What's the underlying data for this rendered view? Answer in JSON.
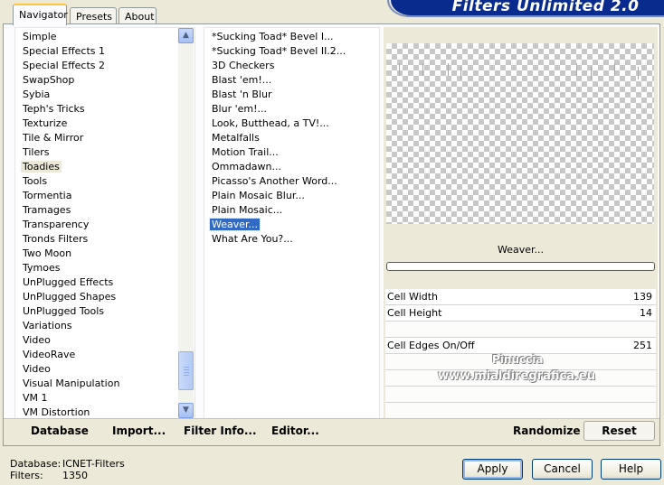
{
  "banner": {
    "title": "Filters Unlimited 2.0"
  },
  "tabs": [
    {
      "label": "Navigator",
      "active": true
    },
    {
      "label": "Presets",
      "active": false
    },
    {
      "label": "About",
      "active": false
    }
  ],
  "categories": {
    "items": [
      "Simple",
      "Special Effects 1",
      "Special Effects 2",
      "SwapShop",
      "Sybia",
      "Teph's Tricks",
      "Texturize",
      "Tile & Mirror",
      "Tilers",
      "Toadies",
      "Tools",
      "Tormentia",
      "Tramages",
      "Transparency",
      "Tronds Filters",
      "Two Moon",
      "Tymoes",
      "UnPlugged Effects",
      "UnPlugged Shapes",
      "UnPlugged Tools",
      "Variations",
      "Video",
      "VideoRave",
      "Video",
      "Visual Manipulation",
      "VM 1",
      "VM Distortion"
    ],
    "selected": "Toadies",
    "scroll_position": 0.86
  },
  "filters": {
    "items": [
      "*Sucking Toad*  Bevel I...",
      "*Sucking Toad*  Bevel II.2...",
      "3D Checkers",
      "Blast 'em!...",
      "Blast 'n Blur",
      "Blur 'em!...",
      "Look, Butthead, a TV!...",
      "Metalfalls",
      "Motion Trail...",
      "Ommadawn...",
      "Picasso's Another Word...",
      "Plain Mosaic Blur...",
      "Plain Mosaic...",
      "Weaver...",
      "What Are You?..."
    ],
    "selected": "Weaver..."
  },
  "preview": {
    "filter_name": "Weaver..."
  },
  "params": [
    {
      "label": "Cell Width",
      "value": "139"
    },
    {
      "label": "Cell Height",
      "value": "14"
    },
    {
      "label": "",
      "value": ""
    },
    {
      "label": "Cell Edges On/Off",
      "value": "251"
    }
  ],
  "watermark": {
    "line1": "Pinuccia",
    "line2": "www.mialdiregrafica.eu"
  },
  "toolbar": {
    "database": "Database",
    "import": "Import...",
    "filter_info": "Filter Info...",
    "editor": "Editor...",
    "randomize": "Randomize",
    "reset": "Reset"
  },
  "status": {
    "database_label": "Database:",
    "database_value": "ICNET-Filters",
    "filters_label": "Filters:",
    "filters_value": "1350"
  },
  "buttons": {
    "apply": "Apply",
    "cancel": "Cancel",
    "help": "Help"
  },
  "icons": {
    "scroll_up": "arrow-up-icon",
    "scroll_down": "arrow-down-icon"
  }
}
